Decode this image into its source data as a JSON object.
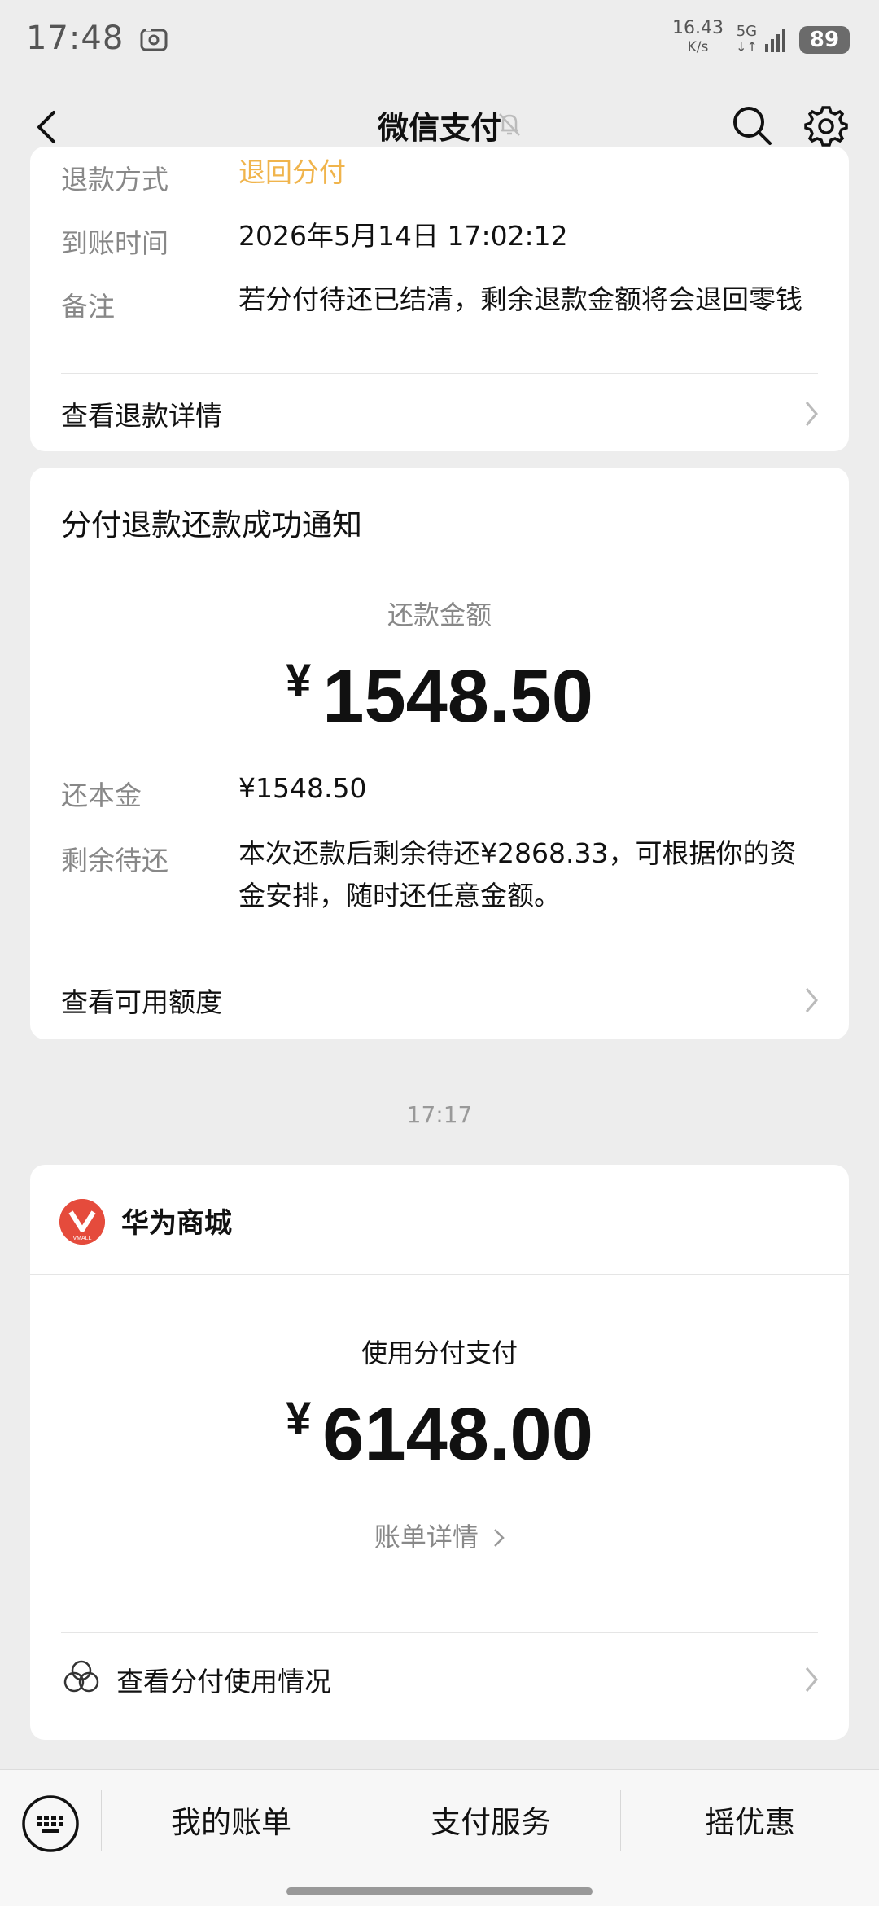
{
  "status_bar": {
    "time": "17:48",
    "net_speed_value": "16.43",
    "net_speed_unit": "K/s",
    "network": "5G",
    "battery": "89"
  },
  "nav": {
    "title": "微信支付"
  },
  "refund_card": {
    "rows": [
      {
        "label": "退款方式",
        "value": "退回分付",
        "value_color": "#f0b44c"
      },
      {
        "label": "到账时间",
        "value": "2026年5月14日 17:02:12"
      },
      {
        "label": "备注",
        "value": "若分付待还已结清，剩余退款金额将会退回零钱"
      }
    ],
    "link_label": "查看退款详情"
  },
  "repay_card": {
    "title": "分付退款还款成功通知",
    "amount_label": "还款金额",
    "currency": "¥",
    "amount": "1548.50",
    "rows": [
      {
        "label": "还本金",
        "value": "¥1548.50"
      },
      {
        "label": "剩余待还",
        "value": "本次还款后剩余待还¥2868.33，可根据你的资金安排，随时还任意金额。"
      }
    ],
    "link_label": "查看可用额度"
  },
  "timestamp": "17:17",
  "merchant_card": {
    "merchant_name": "华为商城",
    "logo_text": "VMALL",
    "amount_label": "使用分付支付",
    "currency": "¥",
    "amount": "6148.00",
    "bill_link": "账单详情",
    "link_label": "查看分付使用情况"
  },
  "bottom_menu": {
    "items": [
      "我的账单",
      "支付服务",
      "摇优惠"
    ]
  },
  "colors": {
    "accent_orange": "#f0b44c",
    "logo_red": "#e54b3c",
    "background": "#ededed"
  }
}
